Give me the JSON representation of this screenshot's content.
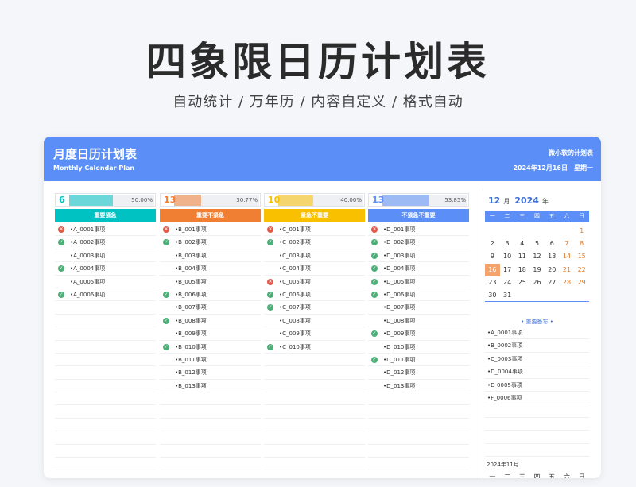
{
  "hero": {
    "title": "四象限日历计划表",
    "subtitle": "自动统计  /   万年历  /  内容自定义  /  格式自动"
  },
  "header": {
    "title": "月度日历计划表",
    "subtitle": "Monthly Calendar Plan",
    "brand": "微小软的计划表",
    "date": "2024年12月16日",
    "weekday": "星期一"
  },
  "colors": {
    "header": "#5b8ef6",
    "q1": "#00c2c2",
    "q2": "#f07f33",
    "q3": "#f9c000",
    "q4": "#5b8ef6",
    "done": "#4caf78",
    "fail": "#e35a4b"
  },
  "quadrants": [
    {
      "count": "6",
      "percent": "50.00%",
      "progress": 0.5,
      "label": "重要紧急",
      "items": [
        {
          "text": "•A_0001事项",
          "status": "fail"
        },
        {
          "text": "•A_0002事项",
          "status": "done"
        },
        {
          "text": "•A_0003事项",
          "status": "none"
        },
        {
          "text": "•A_0004事项",
          "status": "done"
        },
        {
          "text": "•A_0005事项",
          "status": "none"
        },
        {
          "text": "•A_0006事项",
          "status": "done"
        }
      ]
    },
    {
      "count": "13",
      "percent": "30.77%",
      "progress": 0.3077,
      "label": "重要不紧急",
      "items": [
        {
          "text": "•B_001事项",
          "status": "fail"
        },
        {
          "text": "•B_002事项",
          "status": "done"
        },
        {
          "text": "•B_003事项",
          "status": "none"
        },
        {
          "text": "•B_004事项",
          "status": "none"
        },
        {
          "text": "•B_005事项",
          "status": "none"
        },
        {
          "text": "•B_006事项",
          "status": "done"
        },
        {
          "text": "•B_007事项",
          "status": "none"
        },
        {
          "text": "•B_008事项",
          "status": "done"
        },
        {
          "text": "•B_009事项",
          "status": "none"
        },
        {
          "text": "•B_010事项",
          "status": "done"
        },
        {
          "text": "•B_011事项",
          "status": "none"
        },
        {
          "text": "•B_012事项",
          "status": "none"
        },
        {
          "text": "•B_013事项",
          "status": "none"
        }
      ]
    },
    {
      "count": "10",
      "percent": "40.00%",
      "progress": 0.4,
      "label": "紧急不重要",
      "items": [
        {
          "text": "•C_001事项",
          "status": "fail"
        },
        {
          "text": "•C_002事项",
          "status": "done"
        },
        {
          "text": "•C_003事项",
          "status": "none"
        },
        {
          "text": "•C_004事项",
          "status": "none"
        },
        {
          "text": "•C_005事项",
          "status": "fail"
        },
        {
          "text": "•C_006事项",
          "status": "done"
        },
        {
          "text": "•C_007事项",
          "status": "done"
        },
        {
          "text": "•C_008事项",
          "status": "none"
        },
        {
          "text": "•C_009事项",
          "status": "none"
        },
        {
          "text": "•C_010事项",
          "status": "done"
        }
      ]
    },
    {
      "count": "13",
      "percent": "53.85%",
      "progress": 0.5385,
      "label": "不紧急不重要",
      "items": [
        {
          "text": "•D_001事项",
          "status": "fail"
        },
        {
          "text": "•D_002事项",
          "status": "done"
        },
        {
          "text": "•D_003事项",
          "status": "done"
        },
        {
          "text": "•D_004事项",
          "status": "done"
        },
        {
          "text": "•D_005事项",
          "status": "done"
        },
        {
          "text": "•D_006事项",
          "status": "done"
        },
        {
          "text": "•D_007事项",
          "status": "none"
        },
        {
          "text": "•D_008事项",
          "status": "none"
        },
        {
          "text": "•D_009事项",
          "status": "done"
        },
        {
          "text": "•D_010事项",
          "status": "none"
        },
        {
          "text": "•D_011事项",
          "status": "done"
        },
        {
          "text": "•D_012事项",
          "status": "none"
        },
        {
          "text": "•D_013事项",
          "status": "none"
        }
      ]
    }
  ],
  "calendar": {
    "month": "12",
    "month_unit": "月",
    "year": "2024",
    "year_unit": "年",
    "weekdays": [
      "一",
      "二",
      "三",
      "四",
      "五",
      "六",
      "日"
    ],
    "today": "16",
    "weeks": [
      [
        "",
        "",
        "",
        "",
        "",
        "",
        "1"
      ],
      [
        "2",
        "3",
        "4",
        "5",
        "6",
        "7",
        "8"
      ],
      [
        "9",
        "10",
        "11",
        "12",
        "13",
        "14",
        "15"
      ],
      [
        "16",
        "17",
        "18",
        "19",
        "20",
        "21",
        "22"
      ],
      [
        "23",
        "24",
        "25",
        "26",
        "27",
        "28",
        "29"
      ],
      [
        "30",
        "31",
        "",
        "",
        "",
        "",
        ""
      ]
    ]
  },
  "memo": {
    "title": "• 重要备忘 •",
    "items": [
      "•A_0001事项",
      "•B_0002事项",
      "•C_0003事项",
      "•D_0004事项",
      "•E_0005事项",
      "•F_0006事项"
    ]
  },
  "prev_month": {
    "title": "2024年11月",
    "weekdays": [
      "一",
      "二",
      "三",
      "四",
      "五",
      "六",
      "日"
    ]
  }
}
